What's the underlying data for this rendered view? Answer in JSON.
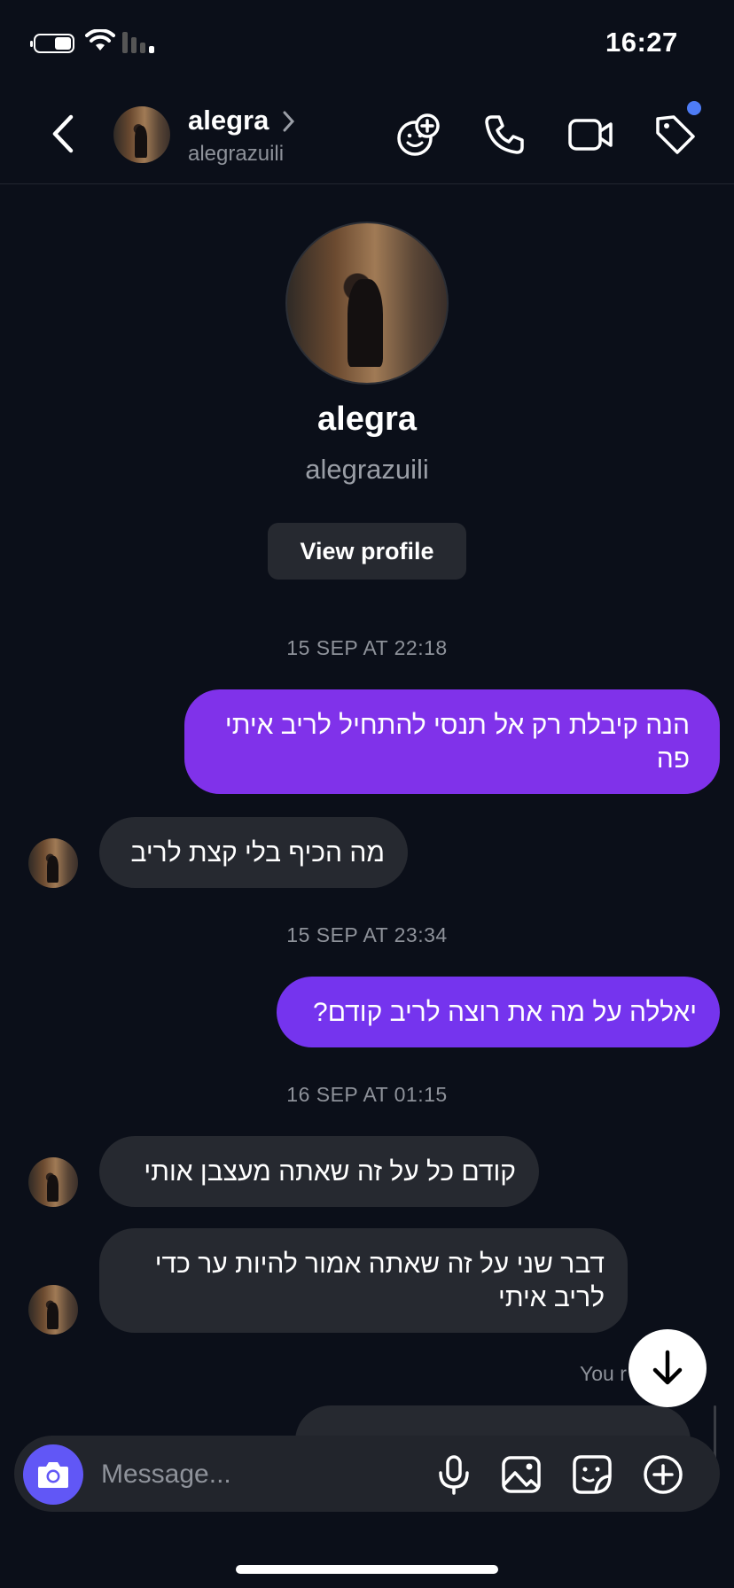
{
  "status_bar": {
    "time": "16:27"
  },
  "header": {
    "name": "alegra",
    "username": "alegrazuili",
    "icons": [
      "back-arrow-icon",
      "sticker-add-icon",
      "phone-icon",
      "video-camera-icon",
      "tag-icon"
    ]
  },
  "profile": {
    "name": "alegra",
    "username": "alegrazuili",
    "view_profile_label": "View profile"
  },
  "messages": [
    {
      "type": "timestamp",
      "text": "15 SEP AT 22:18"
    },
    {
      "type": "sent",
      "text": "הנה קיבלת רק אל תנסי להתחיל לריב איתי פה"
    },
    {
      "type": "received",
      "text": "מה הכיף בלי קצת לריב"
    },
    {
      "type": "timestamp",
      "text": "15 SEP AT 23:34"
    },
    {
      "type": "sent",
      "text": "יאללה על מה את רוצה לריב קודם?"
    },
    {
      "type": "timestamp",
      "text": "16 SEP AT 01:15"
    },
    {
      "type": "received",
      "text": "קודם כל על זה שאתה מעצבן אותי"
    },
    {
      "type": "received",
      "text": "דבר שני על זה שאתה אמור להיות ער כדי לריב איתי"
    }
  ],
  "seen_text": "You r",
  "composer": {
    "placeholder": "Message...",
    "accent_color": "#6157f6"
  },
  "colors": {
    "background": "#0b0f19",
    "sent_bubble": "#8032ea",
    "received_bubble": "#262930",
    "notification_dot": "#4e7cf5"
  }
}
